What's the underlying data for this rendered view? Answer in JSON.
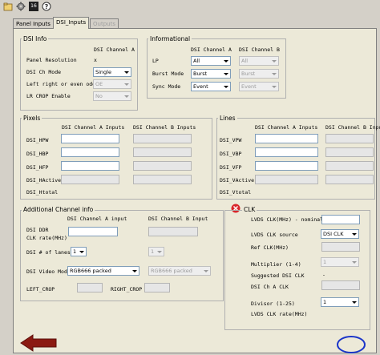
{
  "toolbar": {
    "tool_icon_text": "16"
  },
  "tabs": [
    {
      "label": "Panel Inputs",
      "state": "normal"
    },
    {
      "label": "DSI_Inputs",
      "state": "active"
    },
    {
      "label": "Outputs",
      "state": "disabled"
    }
  ],
  "dsi_info": {
    "title": "DSI Info",
    "col_a": "DSI Channel A",
    "rows": [
      {
        "label": "Panel Resolution",
        "value": "x"
      },
      {
        "label": "DSI Ch Mode",
        "value": "Single"
      },
      {
        "label": "Left right or even odd",
        "value": "OE"
      },
      {
        "label": "LR CROP Enable",
        "value": "No"
      }
    ]
  },
  "informational": {
    "title": "Informational",
    "col_a": "DSI Channel A",
    "col_b": "DSI Channel B",
    "rows": [
      {
        "label": "LP",
        "a": "All",
        "b": "All"
      },
      {
        "label": "Burst Mode",
        "a": "Burst",
        "b": "Burst"
      },
      {
        "label": "Sync Mode",
        "a": "Event",
        "b": "Event"
      }
    ]
  },
  "pixels": {
    "title": "Pixels",
    "col_a": "DSI Channel A Inputs",
    "col_b": "DSI Channel B Inputs",
    "rows": [
      "DSI_HPW",
      "DSI_HBP",
      "DSI_HFP",
      "DSI_HActive",
      "DSI_Htotal"
    ]
  },
  "lines": {
    "title": "Lines",
    "col_a": "DSI Channel A Inputs",
    "col_b": "DSI Channel B Inputs",
    "rows": [
      "DSI_VPW",
      "DSI_VBP",
      "DSI_VFP",
      "DSI_VActive",
      "DSI_Vtotal"
    ]
  },
  "additional": {
    "title": "Additional Channel info",
    "col_a": "DSI Channel A input",
    "col_b": "DSI Channel B Input",
    "ddr_label_1": "DSI DDR",
    "ddr_label_2": "CLK rate(MHz)",
    "lanes_label": "DSI # of lanes",
    "lanes_a": "1",
    "lanes_b": "1",
    "video_mode_label": "DSI Video Mode",
    "video_mode_a": "RGB666 packed",
    "video_mode_b": "RGB666 packed",
    "left_crop_label": "LEFT_CROP",
    "right_crop_label": "RIGHT_CROP"
  },
  "clk": {
    "title": "CLK",
    "lvds_nominal_label": "LVDS CLK(MHz) - nominal",
    "lvds_source_label": "LVDS CLK source",
    "lvds_source_value": "DSI CLK",
    "ref_clk_label": "Ref CLK(MHz)",
    "multiplier_label": "Multiplier (1-4)",
    "multiplier_value": "1",
    "suggested_label": "Suggested DSI CLK",
    "suggested_value": "-",
    "dsi_cha_clk_label": "DSI Ch A CLK",
    "divisor_label": "Divisor (1-25)",
    "divisor_value": "1",
    "lvds_rate_label": "LVDS CLK rate(MHz)"
  },
  "colors": {
    "error_red": "#d9262b",
    "back_arrow": "#8b1a12",
    "annotation_blue": "#1a35c9"
  }
}
